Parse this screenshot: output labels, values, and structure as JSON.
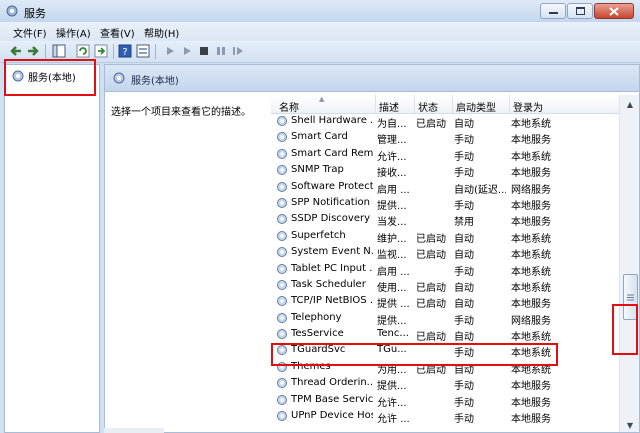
{
  "window": {
    "title": "服务"
  },
  "menu": [
    {
      "label": "文件(F)"
    },
    {
      "label": "操作(A)"
    },
    {
      "label": "查看(V)"
    },
    {
      "label": "帮助(H)"
    }
  ],
  "toolbar": {
    "icons": [
      "back-icon",
      "forward-icon",
      "console-tree-icon",
      "refresh-icon",
      "export-icon",
      "help-icon",
      "properties-icon",
      "start-icon",
      "start-alt-icon",
      "stop-icon",
      "pause-icon",
      "restart-icon"
    ]
  },
  "tree": {
    "root_label": "服务(本地)"
  },
  "header": {
    "title": "服务(本地)"
  },
  "description_prompt": "选择一个项目来查看它的描述。",
  "columns": {
    "name": "名称",
    "description": "描述",
    "status": "状态",
    "startup": "启动类型",
    "logon": "登录为"
  },
  "services": [
    {
      "name": "Shell Hardware ...",
      "description": "为自...",
      "status": "已启动",
      "startup": "自动",
      "logon": "本地系统"
    },
    {
      "name": "Smart Card",
      "description": "管理...",
      "status": "",
      "startup": "手动",
      "logon": "本地服务"
    },
    {
      "name": "Smart Card Rem...",
      "description": "允许...",
      "status": "",
      "startup": "手动",
      "logon": "本地系统"
    },
    {
      "name": "SNMP Trap",
      "description": "接收...",
      "status": "",
      "startup": "手动",
      "logon": "本地服务"
    },
    {
      "name": "Software Protect...",
      "description": "启用 ...",
      "status": "",
      "startup": "自动(延迟...",
      "logon": "网络服务"
    },
    {
      "name": "SPP Notification ...",
      "description": "提供...",
      "status": "",
      "startup": "手动",
      "logon": "本地服务"
    },
    {
      "name": "SSDP Discovery",
      "description": "当发...",
      "status": "",
      "startup": "禁用",
      "logon": "本地服务"
    },
    {
      "name": "Superfetch",
      "description": "维护...",
      "status": "已启动",
      "startup": "自动",
      "logon": "本地系统"
    },
    {
      "name": "System Event N...",
      "description": "监视...",
      "status": "已启动",
      "startup": "自动",
      "logon": "本地系统"
    },
    {
      "name": "Tablet PC Input ...",
      "description": "启用 ...",
      "status": "",
      "startup": "手动",
      "logon": "本地系统"
    },
    {
      "name": "Task Scheduler",
      "description": "使用...",
      "status": "已启动",
      "startup": "自动",
      "logon": "本地系统"
    },
    {
      "name": "TCP/IP NetBIOS ...",
      "description": "提供 ...",
      "status": "已启动",
      "startup": "自动",
      "logon": "本地服务"
    },
    {
      "name": "Telephony",
      "description": "提供...",
      "status": "",
      "startup": "手动",
      "logon": "网络服务"
    },
    {
      "name": "TesService",
      "description": "Tenc...",
      "status": "已启动",
      "startup": "自动",
      "logon": "本地系统"
    },
    {
      "name": "TGuardSvc",
      "description": "TGu...",
      "status": "",
      "startup": "手动",
      "logon": "本地系统"
    },
    {
      "name": "Themes",
      "description": "为用...",
      "status": "已启动",
      "startup": "自动",
      "logon": "本地系统"
    },
    {
      "name": "Thread Orderin...",
      "description": "提供...",
      "status": "",
      "startup": "手动",
      "logon": "本地服务"
    },
    {
      "name": "TPM Base Servic...",
      "description": "允许...",
      "status": "",
      "startup": "手动",
      "logon": "本地服务"
    },
    {
      "name": "UPnP Device Host",
      "description": "允许 ...",
      "status": "",
      "startup": "手动",
      "logon": "本地服务"
    }
  ],
  "scroll_position": 0.62,
  "colors": {
    "highlight_box": "#e01010",
    "title_bar": "#c3d6ee"
  }
}
